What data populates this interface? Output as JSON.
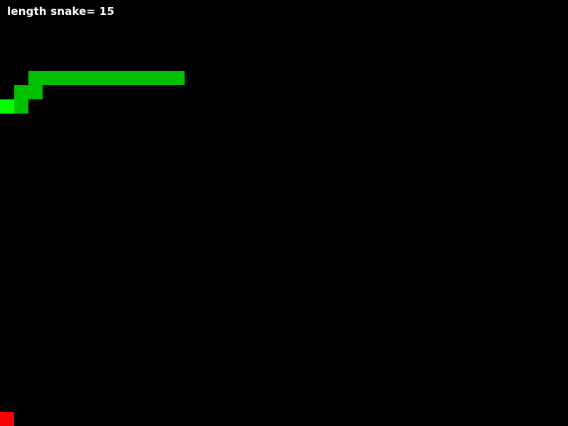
{
  "hud": {
    "score_label": "length snake= 15"
  },
  "game": {
    "colors": {
      "background": "#000000",
      "snake_body": "#00c000",
      "snake_head": "#00ff00",
      "food": "#ff0000"
    },
    "snake": {
      "length": 15,
      "head": [
        0,
        7
      ],
      "body": [
        [
          1,
          7
        ],
        [
          1,
          6
        ],
        [
          2,
          6
        ],
        [
          2,
          5
        ],
        [
          3,
          5
        ],
        [
          4,
          5
        ],
        [
          5,
          5
        ],
        [
          6,
          5
        ],
        [
          7,
          5
        ],
        [
          8,
          5
        ],
        [
          9,
          5
        ],
        [
          10,
          5
        ],
        [
          11,
          5
        ],
        [
          12,
          5
        ]
      ]
    },
    "food": [
      0,
      29
    ]
  }
}
